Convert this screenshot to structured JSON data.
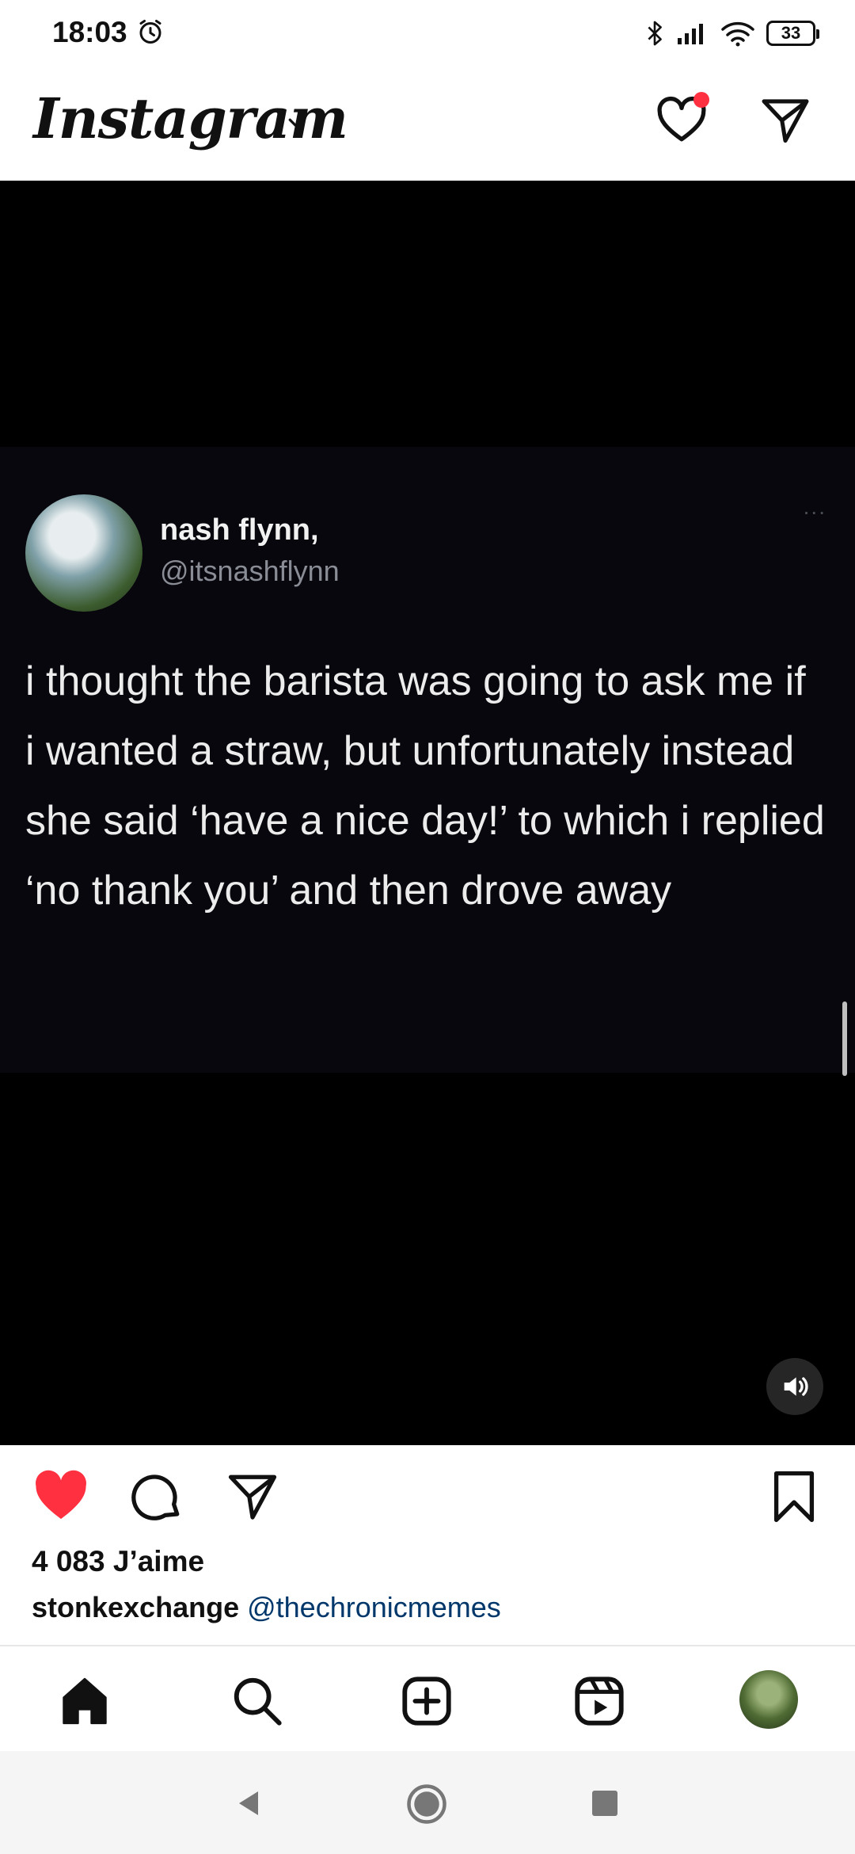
{
  "status_bar": {
    "time": "18:03",
    "battery": "33"
  },
  "app_bar": {
    "logo": "Instagram",
    "notification_dot_color": "#ff3040"
  },
  "post": {
    "tweet": {
      "name": "nash flynn,",
      "handle": "@itsnashflynn",
      "more": "...",
      "text": "i thought the barista was going to ask me if i wanted a straw, but unfortunately instead she said ‘have a nice day!’ to which i replied ‘no thank you’ and then drove away"
    },
    "liked": true,
    "like_color": "#ff3040",
    "likes": "4 083 J’aime",
    "caption_user": "stonkexchange",
    "caption_mention": "@thechronicmemes"
  },
  "bottom_nav": {
    "items": [
      "home-icon",
      "search-icon",
      "new-post-icon",
      "reels-icon",
      "profile-avatar"
    ]
  }
}
